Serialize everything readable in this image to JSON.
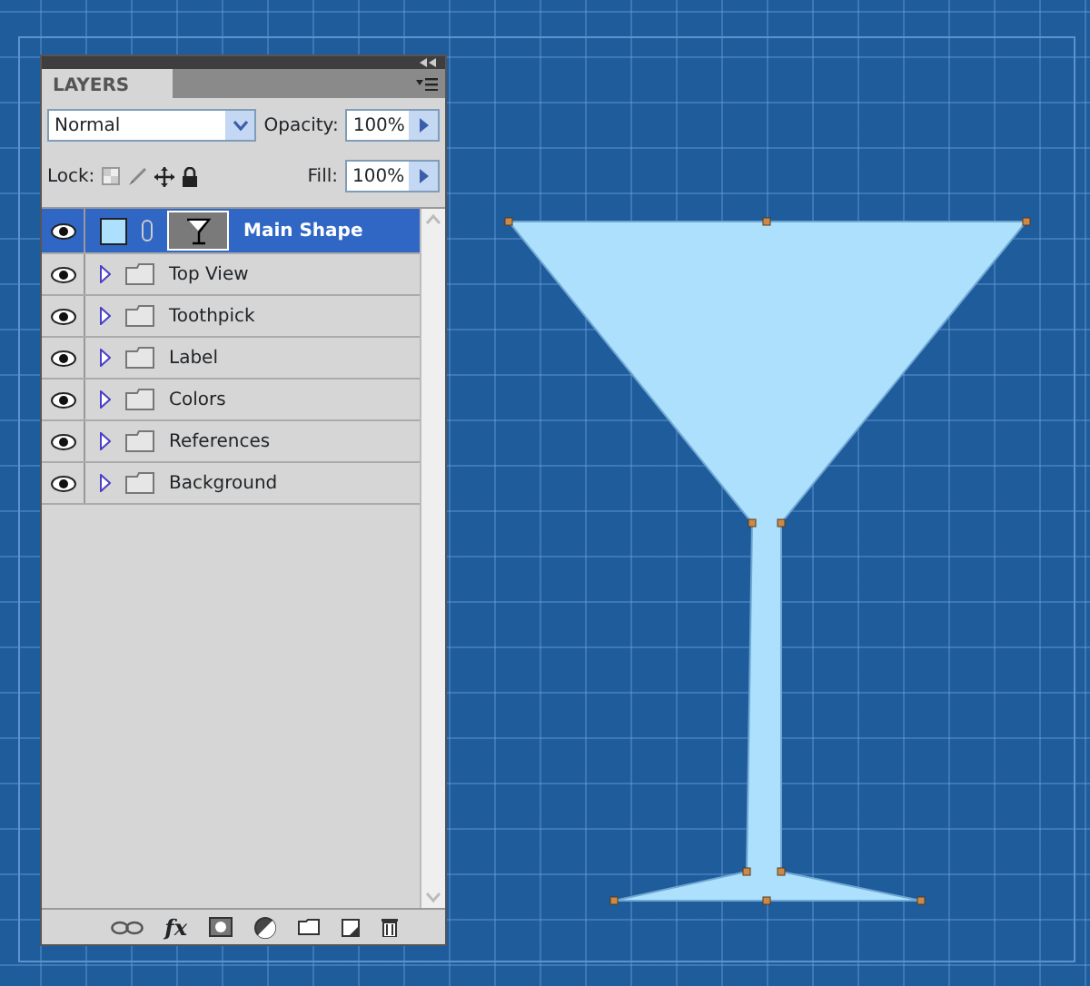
{
  "panel": {
    "title": "LAYERS",
    "blend_mode": "Normal",
    "opacity_label": "Opacity:",
    "opacity": "100%",
    "lock_label": "Lock:",
    "fill_label": "Fill:",
    "fill": "100%"
  },
  "layers": [
    {
      "name": "Main Shape",
      "kind": "shape",
      "selected": true,
      "visible": true
    },
    {
      "name": "Top View",
      "kind": "group",
      "selected": false,
      "visible": true
    },
    {
      "name": "Toothpick",
      "kind": "group",
      "selected": false,
      "visible": true
    },
    {
      "name": "Label",
      "kind": "group",
      "selected": false,
      "visible": true
    },
    {
      "name": "Colors",
      "kind": "group",
      "selected": false,
      "visible": true
    },
    {
      "name": "References",
      "kind": "group",
      "selected": false,
      "visible": true
    },
    {
      "name": "Background",
      "kind": "group",
      "selected": false,
      "visible": true
    }
  ],
  "toolbar": {
    "fx_label": "fx"
  }
}
